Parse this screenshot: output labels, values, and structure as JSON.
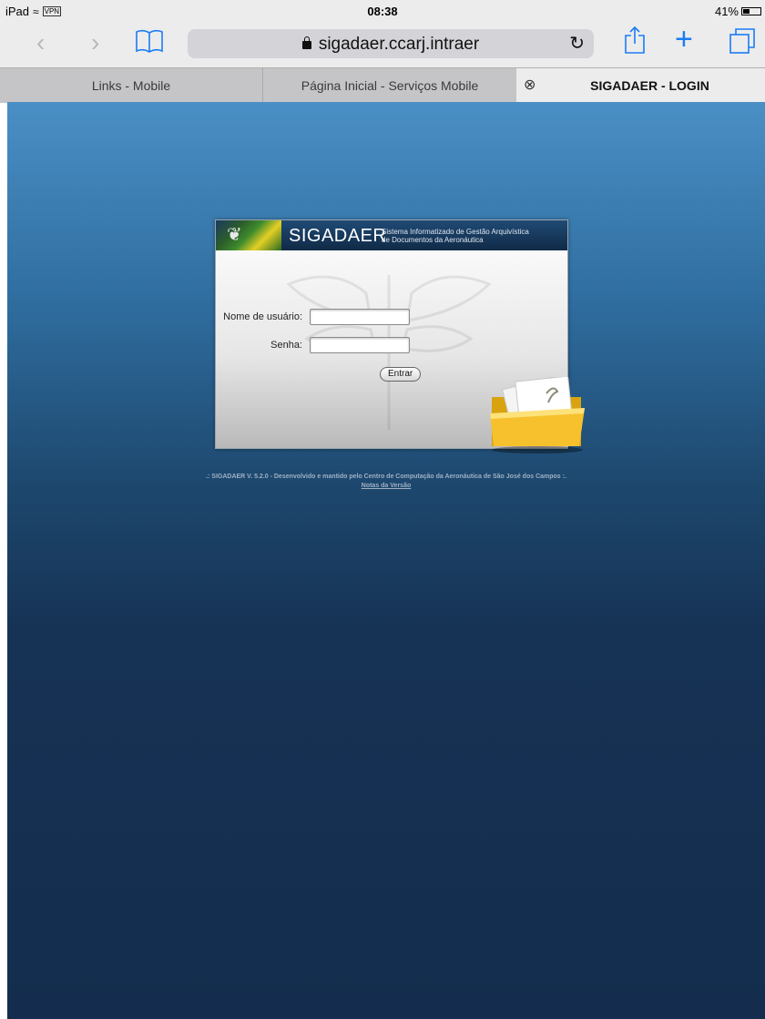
{
  "statusbar": {
    "device": "iPad",
    "vpn": "VPN",
    "time": "08:38",
    "battery": "41%",
    "battery_level": 0.41
  },
  "toolbar": {
    "url": "sigadaer.ccarj.intraer",
    "icons": [
      "back-icon",
      "forward-icon",
      "bookmarks-icon",
      "lock-icon",
      "reload-icon",
      "share-icon",
      "new-tab-icon",
      "tabs-icon"
    ]
  },
  "tabs": [
    {
      "label": "Links - Mobile"
    },
    {
      "label": "Página Inicial - Serviços Mobile"
    },
    {
      "label": "SIGADAER - LOGIN",
      "active": true
    }
  ],
  "login": {
    "brand": "SIGADAER",
    "tagline_line1": "Sistema Informatizado de Gestão Arquivística",
    "tagline_line2": "de Documentos da Aeronáutica",
    "username_label": "Nome de usuário:",
    "username_value": "",
    "password_label": "Senha:",
    "password_value": "",
    "submit_label": "Entrar"
  },
  "footer": {
    "text": ".: SIGADAER V. 5.2.0 - Desenvolvido e mantido pelo Centro de Computação da Aeronáutica de São José dos Campos :.",
    "link": "Notas da Versão"
  },
  "colors": {
    "accent": "#1a7cf5",
    "page_top": "#4a8fc5",
    "page_bottom": "#142d4e",
    "header_bg": "#112a47"
  }
}
